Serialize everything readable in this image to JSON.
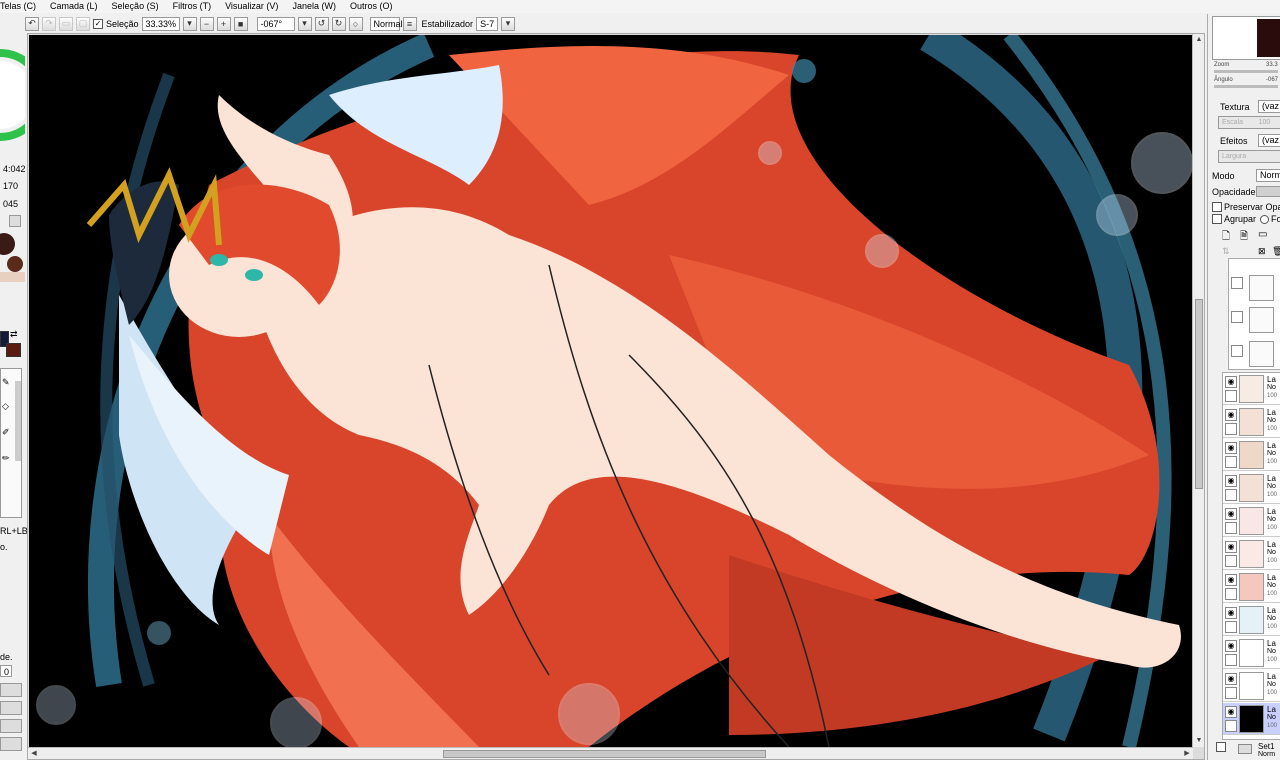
{
  "menu": [
    "Telas (C)",
    "Camada (L)",
    "Seleção (S)",
    "Filtros (T)",
    "Visualizar (V)",
    "Janela (W)",
    "Outros (O)"
  ],
  "toolbar": {
    "selection_label": "Seleção",
    "selection_checked": true,
    "zoom": "33.33%",
    "angle": "-067°",
    "blend_mode": "Normal",
    "stabilizer_label": "Estabilizador",
    "stabilizer_value": "S-7"
  },
  "left_panel": {
    "values": [
      "4:042",
      "170",
      "045"
    ],
    "hint_text": "RL+LB",
    "footer_text": "de.",
    "footer_value": "0"
  },
  "navigator": {
    "zoom_label": "Zoom",
    "zoom_value": "33.3",
    "angle_label": "Ângulo",
    "angle_value": "-067"
  },
  "properties": {
    "texture_label": "Textura",
    "texture_value": "(vaz",
    "scale_label": "Escala",
    "scale_value": "100",
    "effects_label": "Efeitos",
    "effects_value": "(vaz",
    "width_label": "Largura",
    "mode_label": "Modo",
    "mode_value": "Norma",
    "opacity_label": "Opacidade",
    "preserve_label": "Preservar Opaci",
    "group_label": "Agrupar",
    "source_label": "Fo"
  },
  "layers": [
    {
      "name": "La",
      "mode": "No",
      "opacity": "100",
      "thumb": "#f6ece4"
    },
    {
      "name": "La",
      "mode": "No",
      "opacity": "100",
      "thumb": "#f4e0d4"
    },
    {
      "name": "La",
      "mode": "No",
      "opacity": "100",
      "thumb": "#efd8c8"
    },
    {
      "name": "La",
      "mode": "No",
      "opacity": "100",
      "thumb": "#f3e1d6"
    },
    {
      "name": "La",
      "mode": "No",
      "opacity": "100",
      "thumb": "#f9e6e6"
    },
    {
      "name": "La",
      "mode": "No",
      "opacity": "100",
      "thumb": "#fbe9e6"
    },
    {
      "name": "La",
      "mode": "No",
      "opacity": "100",
      "thumb": "#f4c8bd"
    },
    {
      "name": "La",
      "mode": "No",
      "opacity": "100",
      "thumb": "#e4f2f8"
    },
    {
      "name": "La",
      "mode": "No",
      "opacity": "100",
      "thumb": "#ffffff"
    },
    {
      "name": "La",
      "mode": "No",
      "opacity": "100",
      "thumb": "#ffffff"
    },
    {
      "name": "La",
      "mode": "No",
      "opacity": "100",
      "thumb": "#000000"
    }
  ],
  "layer_set": {
    "name": "Set1",
    "mode": "Norm"
  },
  "canvas_colors": {
    "background": "#000000",
    "hair": "#e5502f",
    "cloth": "#ddeeff",
    "water": "#2e6e8c",
    "skin": "#fbe3d5"
  }
}
